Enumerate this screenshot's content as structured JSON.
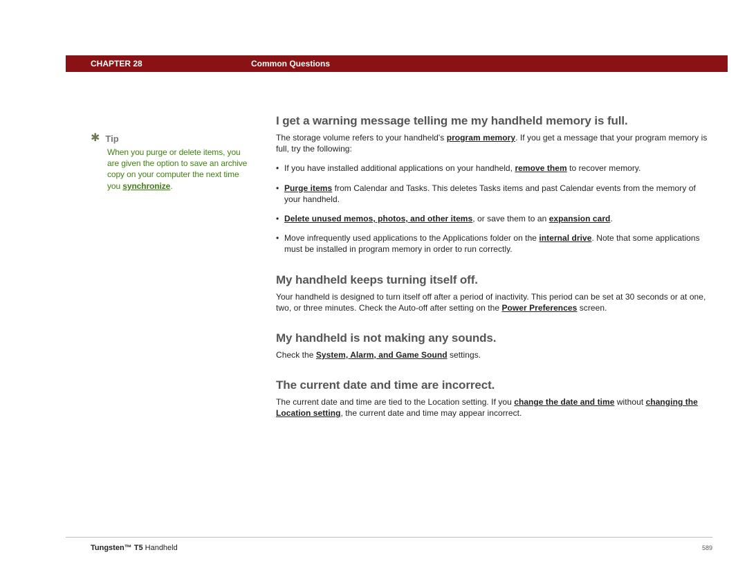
{
  "header": {
    "chapter": "CHAPTER 28",
    "title": "Common Questions"
  },
  "sidebar": {
    "tip_label": "Tip",
    "tip_body_1": "When you purge or delete items, you are given the option to save an archive copy on your computer the next time you ",
    "tip_link": "synchronize",
    "tip_body_2": "."
  },
  "q1": {
    "heading": "I get a warning message telling me my handheld memory is full.",
    "intro_1": "The storage volume refers to your handheld's ",
    "intro_link": "program memory",
    "intro_2": ". If you get a message that your program memory is full, try the following:",
    "b1_1": "If you have installed additional applications on your handheld, ",
    "b1_link": "remove them",
    "b1_2": " to recover memory.",
    "b2_link": "Purge items",
    "b2_rest": " from Calendar and Tasks. This deletes Tasks items and past Calendar events from the memory of your handheld.",
    "b3_link1": "Delete unused memos, photos, and other items",
    "b3_mid": ", or save them to an ",
    "b3_link2": "expansion card",
    "b3_end": ".",
    "b4_1": "Move infrequently used applications to the Applications folder on the ",
    "b4_link": "internal drive",
    "b4_2": ". Note that some applications must be installed in program memory in order to run correctly."
  },
  "q2": {
    "heading": "My handheld keeps turning itself off.",
    "p_1": "Your handheld is designed to turn itself off after a period of inactivity. This period can be set at 30 seconds or at one, two, or three minutes. Check the Auto-off after setting on the ",
    "p_link": "Power Preferences",
    "p_2": " screen."
  },
  "q3": {
    "heading": "My handheld is not making any sounds.",
    "p_1": "Check the ",
    "p_link": "System, Alarm, and Game Sound",
    "p_2": " settings."
  },
  "q4": {
    "heading": "The current date and time are incorrect.",
    "p_1": "The current date and time are tied to the Location setting. If you ",
    "p_link1": "change the date and time",
    "p_mid": " without ",
    "p_link2": "changing the Location setting",
    "p_2": ", the current date and time may appear incorrect."
  },
  "footer": {
    "product_bold": "Tungsten™ T5",
    "product_rest": " Handheld",
    "page": "589"
  }
}
